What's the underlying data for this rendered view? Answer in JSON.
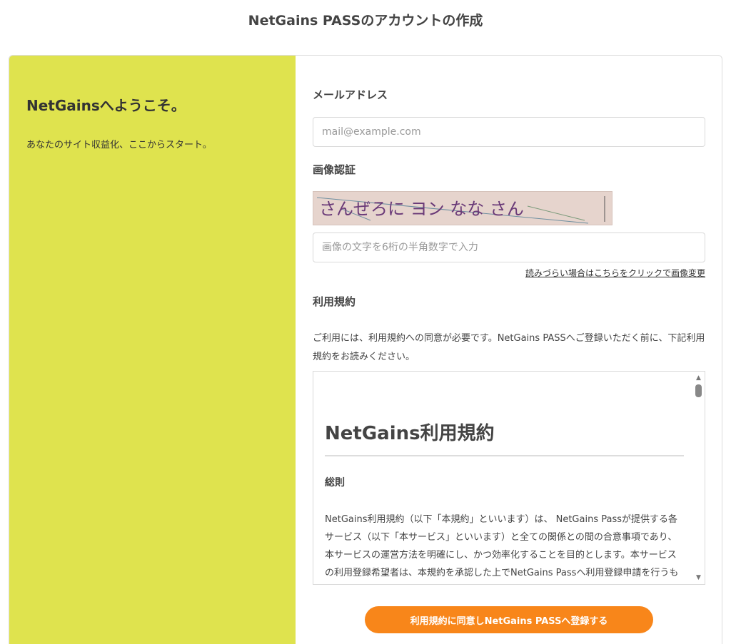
{
  "page": {
    "title": "NetGains PASSのアカウントの作成"
  },
  "left": {
    "welcome": "NetGainsへようこそ。",
    "tagline": "あなたのサイト収益化、ここからスタート。"
  },
  "form": {
    "email_label": "メールアドレス",
    "email_placeholder": "mail@example.com",
    "captcha_label": "画像認証",
    "captcha_text": "さんぜろに ヨン なな さん",
    "captcha_placeholder": "画像の文字を6桁の半角数字で入力",
    "captcha_refresh_link": "読みづらい場合はこちらをクリックで画像変更",
    "terms_label": "利用規約",
    "terms_intro": "ご利用には、利用規約への同意が必要です。NetGains PASSへご登録いただく前に、下記利用規約をお読みください。",
    "terms": {
      "heading": "NetGains利用規約",
      "section": "総則",
      "body": "NetGains利用規約（以下「本規約」といいます）は、 NetGains Passが提供する各サービス（以下「本サービス」といいます）と全ての関係との間の合意事項であり、本サービスの運営方法を明確にし、かつ効率化することを目的とします。本サービスの利用登録希望者は、本規約を承認した上でNetGains Passへ利用登録申請を行うものとします。本サービスの利用は、NetGains Passの利用"
    },
    "submit_label": "利用規約に同意しNetGains PASSへ登録する"
  },
  "colors": {
    "left_panel_bg": "#dfe34e",
    "submit_bg": "#f8861a"
  }
}
